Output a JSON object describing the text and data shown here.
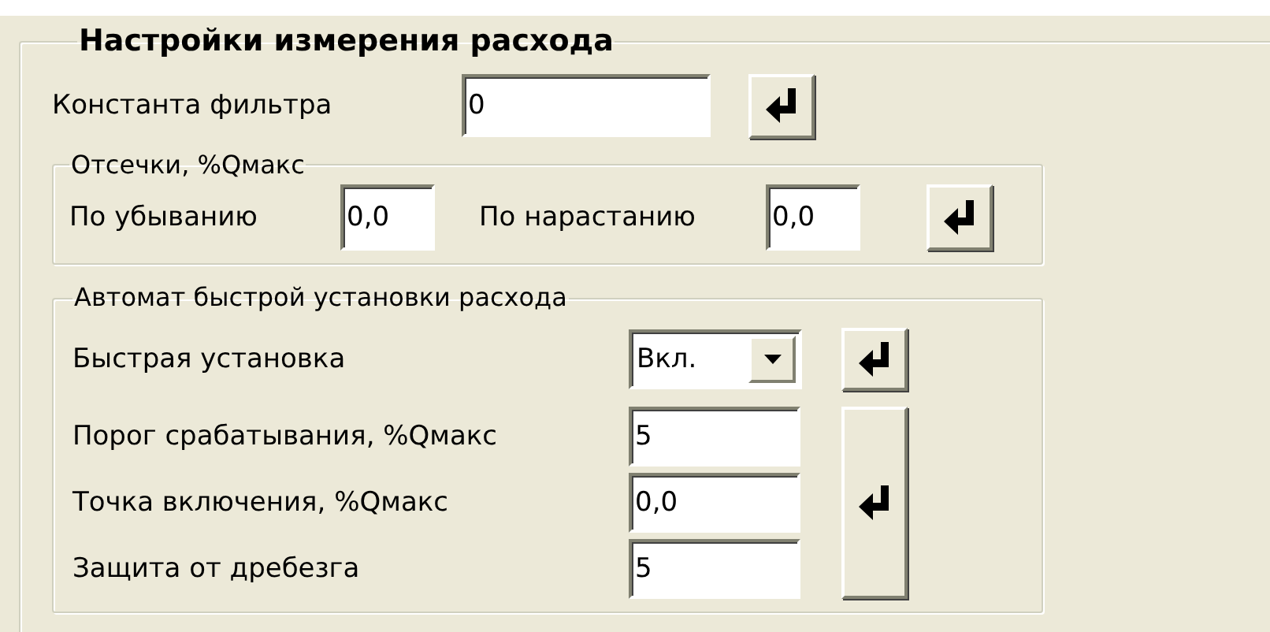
{
  "group": {
    "title": "Настройки измерения расхода"
  },
  "filter": {
    "label": "Константа фильтра",
    "value": "0"
  },
  "cutoffs": {
    "title": "Отсечки, %Qмакс",
    "fields": [
      {
        "label": "По убыванию",
        "value": "0,0"
      },
      {
        "label": "По нарастанию",
        "value": "0,0"
      }
    ]
  },
  "auto": {
    "title": "Автомат быстрой установки расхода",
    "quick": {
      "label": "Быстрая установка",
      "value": "Вкл."
    },
    "fields": [
      {
        "label": "Порог срабатывания, %Qмакс",
        "value": "5"
      },
      {
        "label": "Точка включения, %Qмакс",
        "value": "0,0"
      },
      {
        "label": "Защита от дребезга",
        "value": "5"
      }
    ]
  }
}
